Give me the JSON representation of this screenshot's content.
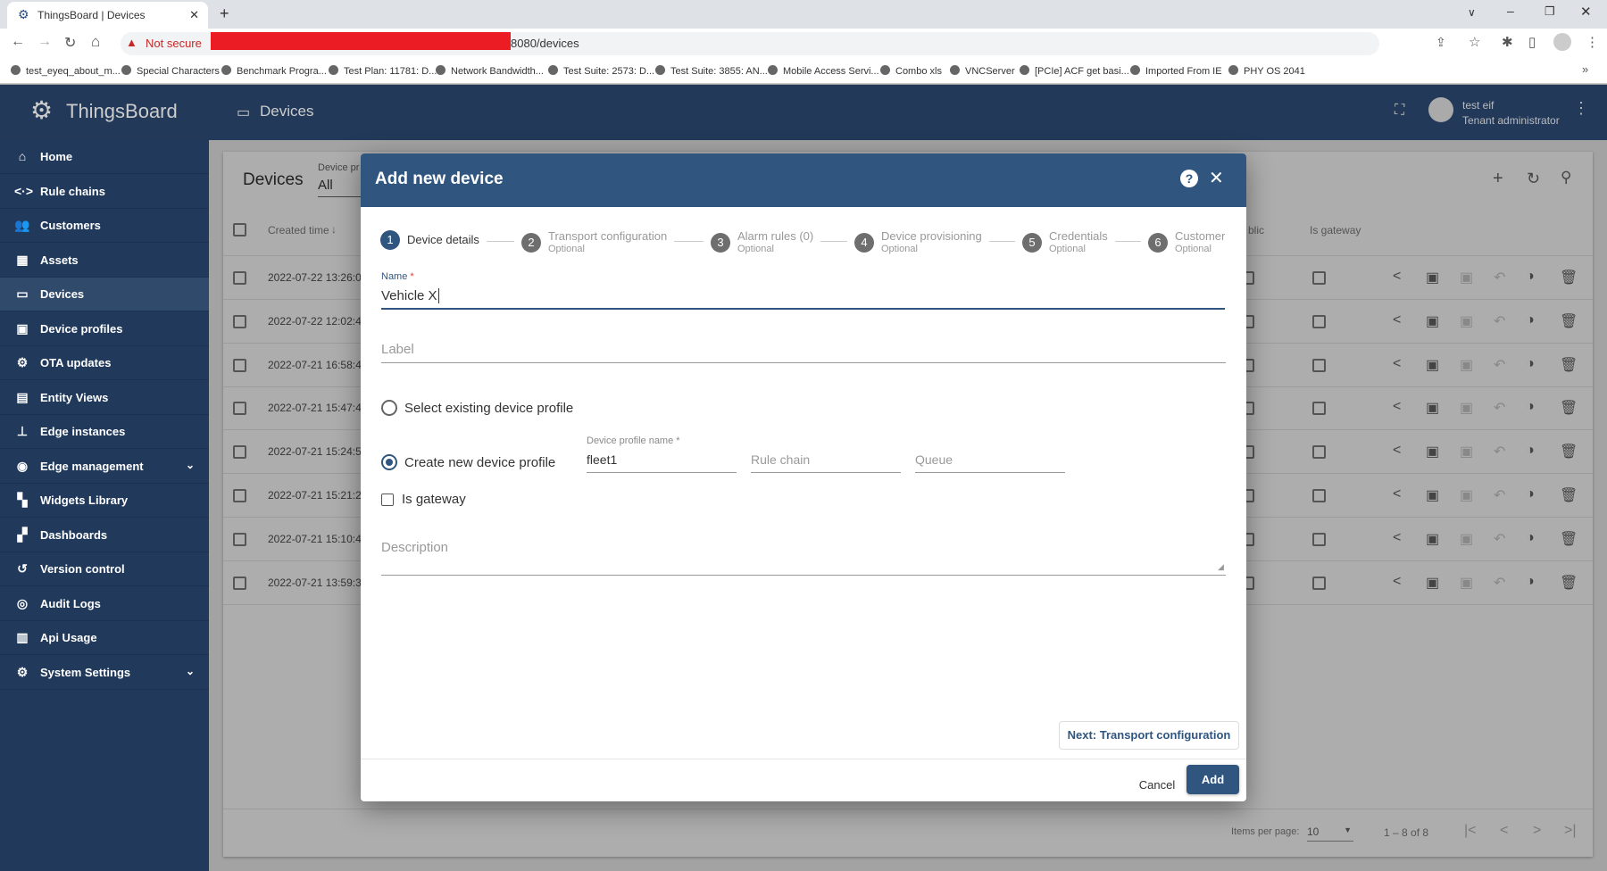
{
  "browser": {
    "tab_title": "ThingsBoard | Devices",
    "new_tab": "+",
    "not_secure": "Not secure",
    "url_suffix": "8080/devices",
    "bookmarks": [
      "test_eyeq_about_m...",
      "Special Characters",
      "Benchmark Progra...",
      "Test Plan: 11781: D...",
      "Network Bandwidth...",
      "Test Suite: 2573: D...",
      "Test Suite: 3855: AN...",
      "Mobile Access Servi...",
      "Combo xls",
      "VNCServer",
      "[PCIe] ACF get basi...",
      "Imported From IE",
      "PHY OS 2041"
    ],
    "more": "»"
  },
  "app": {
    "logo": "ThingsBoard",
    "page_title": "Devices",
    "user_name": "test eif",
    "user_role": "Tenant administrator"
  },
  "sidebar": {
    "items": [
      {
        "label": "Home",
        "icon": "home-icon",
        "glyph": "⌂"
      },
      {
        "label": "Rule chains",
        "icon": "rule-chains-icon",
        "glyph": "<·>"
      },
      {
        "label": "Customers",
        "icon": "customers-icon",
        "glyph": "👥"
      },
      {
        "label": "Assets",
        "icon": "assets-icon",
        "glyph": "▦"
      },
      {
        "label": "Devices",
        "icon": "devices-icon",
        "glyph": "▭",
        "active": true
      },
      {
        "label": "Device profiles",
        "icon": "device-profiles-icon",
        "glyph": "▣"
      },
      {
        "label": "OTA updates",
        "icon": "ota-icon",
        "glyph": "⚙"
      },
      {
        "label": "Entity Views",
        "icon": "entity-views-icon",
        "glyph": "▤"
      },
      {
        "label": "Edge instances",
        "icon": "edge-icon",
        "glyph": "⊥"
      },
      {
        "label": "Edge management",
        "icon": "edge-management-icon",
        "glyph": "◉",
        "expand": true
      },
      {
        "label": "Widgets Library",
        "icon": "widgets-icon",
        "glyph": "▚"
      },
      {
        "label": "Dashboards",
        "icon": "dashboards-icon",
        "glyph": "▞"
      },
      {
        "label": "Version control",
        "icon": "history-icon",
        "glyph": "↺"
      },
      {
        "label": "Audit Logs",
        "icon": "audit-icon",
        "glyph": "◎"
      },
      {
        "label": "Api Usage",
        "icon": "api-usage-icon",
        "glyph": "▥"
      },
      {
        "label": "System Settings",
        "icon": "settings-icon",
        "glyph": "⚙",
        "expand": true
      }
    ]
  },
  "devices_table": {
    "title": "Devices",
    "filter_label": "Device pr",
    "filter_value": "All",
    "col_created": "Created time",
    "col_public": "blic",
    "col_gateway": "Is gateway",
    "rows": [
      "2022-07-22 13:26:0",
      "2022-07-22 12:02:4",
      "2022-07-21 16:58:4",
      "2022-07-21 15:47:4",
      "2022-07-21 15:24:5",
      "2022-07-21 15:21:2",
      "2022-07-21 15:10:4",
      "2022-07-21 13:59:3"
    ],
    "items_per_page_label": "Items per page:",
    "items_per_page": "10",
    "range": "1 – 8 of 8"
  },
  "dialog": {
    "title": "Add new device",
    "steps": [
      {
        "n": "1",
        "label": "Device details",
        "sub": ""
      },
      {
        "n": "2",
        "label": "Transport configuration",
        "sub": "Optional"
      },
      {
        "n": "3",
        "label": "Alarm rules (0)",
        "sub": "Optional"
      },
      {
        "n": "4",
        "label": "Device provisioning",
        "sub": "Optional"
      },
      {
        "n": "5",
        "label": "Credentials",
        "sub": "Optional"
      },
      {
        "n": "6",
        "label": "Customer",
        "sub": "Optional"
      }
    ],
    "name_label": "Name",
    "required": "*",
    "name_value": "Vehicle X",
    "label_placeholder": "Label",
    "radio_existing": "Select existing device profile",
    "radio_new": "Create new device profile",
    "profile_name_label": "Device profile name *",
    "profile_name_value": "fleet1",
    "rule_chain_placeholder": "Rule chain",
    "queue_placeholder": "Queue",
    "is_gateway": "Is gateway",
    "description_placeholder": "Description",
    "next_button": "Next: Transport configuration",
    "cancel": "Cancel",
    "add": "Add"
  },
  "colors": {
    "primary": "#305680",
    "sidebar": "#213a5c",
    "accent_required": "#e53935"
  }
}
